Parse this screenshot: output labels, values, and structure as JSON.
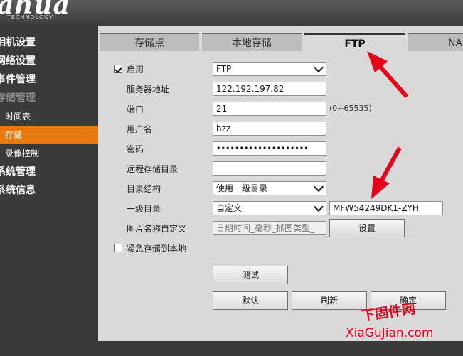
{
  "brand": {
    "logo": "ahua",
    "sub": "TECHNOLOGY"
  },
  "sidebar": {
    "items": [
      {
        "label": "相机设置"
      },
      {
        "label": "网络设置"
      },
      {
        "label": "事件管理"
      },
      {
        "label": "存储管理"
      },
      {
        "label": "时间表"
      },
      {
        "label": "存储"
      },
      {
        "label": "录像控制"
      },
      {
        "label": "系统管理"
      },
      {
        "label": "系统信息"
      }
    ]
  },
  "tabs": [
    {
      "label": "存储点"
    },
    {
      "label": "本地存储"
    },
    {
      "label": "FTP"
    },
    {
      "label": "NAS"
    }
  ],
  "form": {
    "enable_label": "启用",
    "enable_checked": true,
    "protocol": "FTP",
    "server_label": "服务器地址",
    "server_value": "122.192.197.82",
    "port_label": "端口",
    "port_value": "21",
    "port_hint": "(0~65535)",
    "user_label": "用户名",
    "user_value": "hzz",
    "password_label": "密码",
    "password_value": "••••••••••••••••••••",
    "remote_dir_label": "远程存储目录",
    "remote_dir_value": "",
    "dir_struct_label": "目录结构",
    "dir_struct_value": "使用一级目录",
    "first_dir_label": "一级目录",
    "first_dir_select": "自定义",
    "first_dir_value": "MFW54249DK1-ZYH",
    "pic_name_label": "图片名称自定义",
    "pic_name_value": "日期时间_毫秒_抓图类型_",
    "settings_button": "设置",
    "emergency_label": "紧急存储到本地",
    "emergency_checked": false
  },
  "buttons": {
    "test": "测试",
    "default": "默认",
    "refresh": "刷新",
    "confirm": "确定"
  },
  "watermark": {
    "line1": "下固件网",
    "line2": "XiaGuJian.com"
  },
  "colors": {
    "accent": "#e87a12",
    "arrow": "#e4001a"
  }
}
